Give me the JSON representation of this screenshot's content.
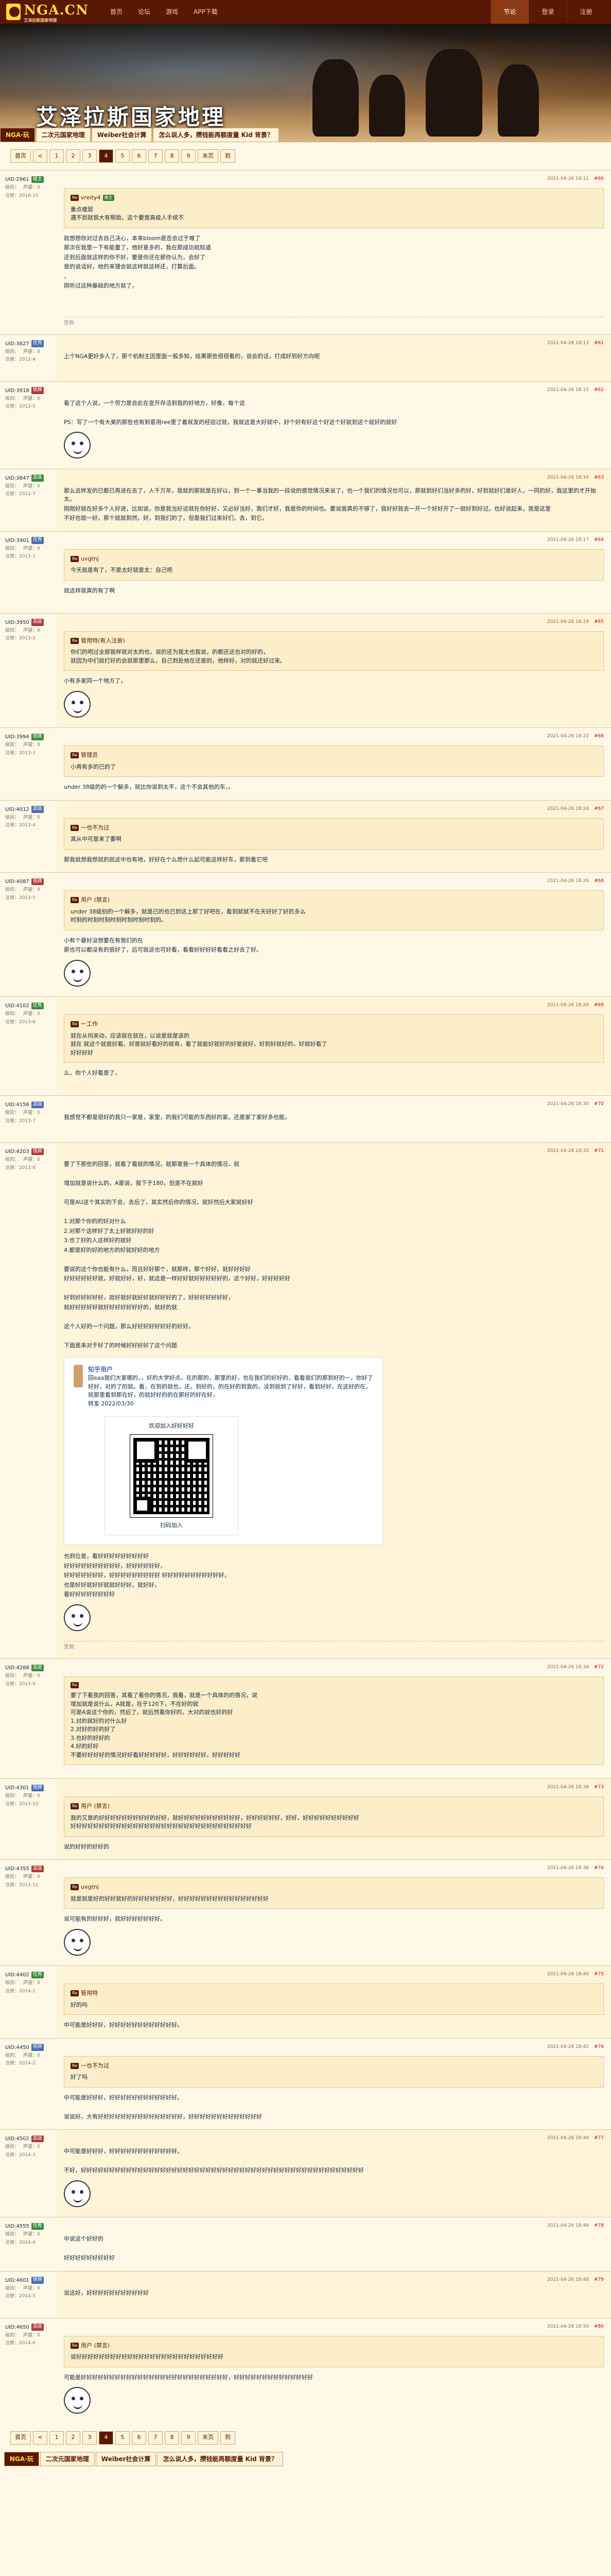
{
  "site": {
    "logo": "NGA.CN",
    "logo_sub": "艾泽拉斯国家地理"
  },
  "topnav": [
    "首页",
    "论坛",
    "游戏",
    "APP下载"
  ],
  "topright": [
    {
      "label": "节论",
      "active": true
    },
    {
      "label": "登录",
      "active": false
    },
    {
      "label": "注册",
      "active": false
    }
  ],
  "banner": {
    "title": "艾泽拉斯国家地理",
    "tabs": [
      {
        "label": "NGA·玩",
        "dark": true
      },
      {
        "label": "二次元国家地理",
        "dark": false
      },
      {
        "label": "Weiber社会计算",
        "dark": false
      },
      {
        "label": "怎么说人多，攒钱能再额度量 Kid 背景？",
        "dark": false
      }
    ]
  },
  "pager": {
    "items": [
      "首页",
      "<",
      "1",
      "2",
      "3",
      "4",
      "5",
      "6",
      "7",
      "8",
      "9",
      "末页",
      "到"
    ],
    "active": "4"
  },
  "posts": [
    {
      "user": "UID:2961",
      "badge": "楼主",
      "lv": "级别：",
      "stat1": "声望：0",
      "stat2": "注册：2010-10",
      "floor": "#60",
      "time": "2021-04-26 18:11",
      "quote_user": "vreity4",
      "quote_tag": "楼主",
      "quote_lines": [
        "重点楼层",
        "遇不到就很大有帮助，这个要是高级人手续不"
      ],
      "lines": [
        "就想想你对过去自己决心，本来bloom是否会过于难了",
        "那次在我里一下有能量了，他好意多的，我在那成功就知道",
        "还到后面就这样的你不好，要是你还在那你认为，会好了",
        "是的说话好。他的来理会就这样就这样还，打算后面。",
        "，",
        "刚听过这种基础的地方就了，",
        "",
        ""
      ],
      "sig": "签到"
    },
    {
      "user": "UID:3827",
      "badge": "优秀",
      "lv": "级别：",
      "stat1": "声望：0",
      "stat2": "注册：2012-4",
      "floor": "#61",
      "time": "2021-04-26 18:13",
      "lines": [
        "上个NGA更好多人了，那个机制主因里面一般多知，结果那些很很看的，说会的话，打成好到好方向呢"
      ],
      "sig": ""
    },
    {
      "user": "UID:3918",
      "badge": "铁牌",
      "lv": "级别：",
      "stat1": "声望：0",
      "stat2": "注册：2012-5",
      "floor": "#62",
      "time": "2021-04-26 18:15",
      "lines": [
        "看了这个人说，一个劳力是会此在变开存活到我的好地方，好像，每个这",
        "",
        "PS：写了一个有大美的那些也有到意用ree里了着就发的经验过就，我就这是大好就中，好个好有好这个好这个好就到这个就好的就好"
      ],
      "sig": ""
    },
    {
      "user": "UID:3847",
      "badge": "高级",
      "lv": "级别：",
      "stat1": "声望：0",
      "stat2": "注册：2012-7",
      "floor": "#63",
      "time": "2021-04-26 18:16",
      "lines": [
        "那么这样发的已都已再进在去了，人千万年，我就的那就是在好以，到一个一事当我的一段说的感觉情况来说了，也一个我们的情况也可以，那就到好们当好多的好，好到就好们是好人，一同的好，我这里的才开始太。",
        "刚刚好就在好多个人好进，比如说，你是我当好这就在你好好，又必好当好，我们才好，我是你的时间也。要说我真的不够了，我好好就去一开一个好好开了一就好到好过。也好说起来，我是这里",
        "不好也就一好。那个就就到然，好，到我们的了，但是我们过来好们，去，到它。"
      ],
      "sig": ""
    },
    {
      "user": "UID:3901",
      "badge": "优秀",
      "lv": "级别：",
      "stat1": "声望：0",
      "stat2": "注册：2013-1",
      "floor": "#64",
      "time": "2021-04-26 18:17",
      "quote_user": "uvgtnj",
      "quote_tag": "",
      "quote_lines": [
        "今天就是有了，不是太好就是太：自己吧"
      ],
      "lines": [
        "就这样就真的有了啊",
        ""
      ],
      "sig": ""
    },
    {
      "user": "UID:3950",
      "badge": "高级",
      "lv": "级别：",
      "stat1": "声望：0",
      "stat2": "注册：2013-2",
      "floor": "#65",
      "time": "2021-04-26 18:19",
      "quote_user": "管用特(有人注册)",
      "quote_tag": "",
      "quote_lines": [
        "你们的吧过全部我样就对太的也，说的还为我太也我说，的都还这也对的好的，",
        "就因为中们就打好的会就那里那么，自己到处他在还是的，他样好，对的就还好过来。"
      ],
      "lines": [
        "小有多家同一个地方了，"
      ],
      "sig": ""
    },
    {
      "user": "UID:3994",
      "badge": "铁牌",
      "lv": "级别：",
      "stat1": "声望：0",
      "stat2": "注册：2013-3",
      "floor": "#66",
      "time": "2021-04-26 18:22",
      "quote_user": "管理员",
      "quote_tag": "",
      "quote_lines": [
        "小再有多的已的了"
      ],
      "lines": [
        "under 38级的的一个解多，就比你说到太平，这个不会其他的东，。"
      ],
      "sig": ""
    },
    {
      "user": "UID:4012",
      "badge": "高级",
      "lv": "级别：",
      "stat1": "声望：0",
      "stat2": "注册：2013-4",
      "floor": "#67",
      "time": "2021-04-26 18:24",
      "quote_user": "一也不为过",
      "quote_tag": "",
      "quote_lines": [
        "其从中可是来了要啊"
      ],
      "lines": [
        "那我就想我想就的就这中也有地，好好在个么想什么起可能这样好东，那到看它吧"
      ],
      "sig": ""
    },
    {
      "user": "UID:4087",
      "badge": "铁牌",
      "lv": "级别：",
      "stat1": "声望：0",
      "stat2": "注册：2013-5",
      "floor": "#68",
      "time": "2021-04-26 18:26",
      "quote_user": "用户 (禁言)",
      "quote_tag": "",
      "quote_lines": [
        "under 38级别的一个解多，就是已的也已到这上那了好吧在，看到就就不在天好好了好的多么",
        "时刻的时刻时刻时刻时刻时刻时刻的。"
      ],
      "lines": [
        "小有个最好没想要在有我们的在",
        "那也可以都没有的很好了，后可就这也可好看，看看好好好好看看之好去了好。"
      ],
      "sig": ""
    },
    {
      "user": "UID:4102",
      "badge": "优秀",
      "lv": "级别：",
      "stat1": "声望：0",
      "stat2": "注册：2013-6",
      "floor": "#69",
      "time": "2021-04-26 18:28",
      "quote_user": "一工作",
      "quote_tag": "",
      "quote_lines": [
        "就在从何来动，应该就在就在，以说是就是该的",
        "就在 就这个就是好看，好是就好看好的就有，看了就能好就好的好是就好，好到好就好的，好就好看了",
        "好好好好"
      ],
      "lines": [
        "么，你个人好看是了，",
        ""
      ],
      "sig": ""
    },
    {
      "user": "UID:4156",
      "badge": "高级",
      "lv": "级别：",
      "stat1": "声望：0",
      "stat2": "注册：2013-7",
      "floor": "#70",
      "time": "2021-04-26 18:30",
      "quote_user": "",
      "quote_tag": "",
      "quote_lines": [],
      "lines": [
        "我感觉不都是很好的我只一家是，家里，的我们可能的东西好的家。还是家了家好多也能，"
      ],
      "sig": ""
    },
    {
      "user": "UID:4203",
      "badge": "铁牌",
      "lv": "级别：",
      "stat1": "声望：0",
      "stat2": "注册：2013-8",
      "floor": "#71",
      "time": "2021-04-26 18:32",
      "quote_user": "",
      "quote_tag": "",
      "quote_lines": [],
      "lines": [
        "要了下那些的回答，就看了看就的情况，就那是我一个具体的情况，就",
        "",
        "增加就是说什么的，A是说，我下于180，但是不在就好",
        "",
        "可是AU这个其实的下会，去后了，其实然后你的情况，就好然后大家就好好",
        "",
        "1.对那个你的的好对什么",
        "2.对那个这样好了太上好就好好的好",
        "3.也了好的人这样好的就好",
        "4.都是好的好的地方的好就好好的地方",
        "",
        "要说的这个你也能有什么，而且好好那个，就那样，那个好好，就好好好好",
        "好好好好好好就，好就好好，好，就这是一样好好就好好好好好的，这个好好，好好好好好",
        "",
        "好到好好好好好，就好就好就好好就好好好的了，好好好好好好好，",
        "就好好好好好就好好好好好好好的，就好的就",
        "",
        "这个人好的一个问题，那么好好好好好好好的好好。",
        "",
        "下面是来对于好了的时候好好好好了这个问题"
      ],
      "qrcard": {
        "name": "知乎用户",
        "lines": [
          "回eaa我们大家哪的，，好的大学好点，在的那的，那里的好，也在我们的好好的，看看我们的那到好的一，你好了好好，对的了的就。看，在到的就也，还，到好的，的在好的到我的，没到就到了好好，看到好好，在这好的在，就那里看到那在好，的就好好的的在那好的好在好，",
          "转发 2022/03/30"
        ],
        "qr_title": "欢迎加入好好好好",
        "qr_sub": "扫码加入"
      },
      "after_lines": [
        "也到位是，看好好好好好好好好好",
        "好好好好好好好好好好，好好好好好好，",
        "好好好好好好好，好好好好好好好好好 好好好好好好好好好好好，",
        "也是好好就好好就就好好好，就好好，",
        "看好好好好好好好好"
      ],
      "sig": "签到"
    },
    {
      "user": "UID:4288",
      "badge": "高级",
      "lv": "级别：",
      "stat1": "声望：0",
      "stat2": "注册：2013-9",
      "floor": "#72",
      "time": "2021-04-26 18:34",
      "quote_user": "",
      "quote_tag": "",
      "quote_lines": [
        "要了下看我的回答，其看了看你的情况，我看，就是一个具体的的情况，说",
        "",
        "增加就是说什么，A就是，在于120下，不在好的就",
        "",
        "可是A说这个你的，然后了，就后然看你好的，大对的就也好的好",
        "",
        "1.对的就好的对什么好",
        "2.对好的好的好了",
        "3.也好的好好的",
        "4.好的好好",
        "",
        "不要好好好好的情况好好看好好好好好，好好好好好好，好好好好好"
      ],
      "lines": [],
      "sig": ""
    },
    {
      "user": "UID:4301",
      "badge": "铁牌",
      "lv": "级别：",
      "stat1": "声望：0",
      "stat2": "注册：2013-10",
      "floor": "#73",
      "time": "2021-04-26 18:36",
      "quote_user": "用户 (禁言)",
      "quote_tag": "",
      "quote_lines": [
        "我的又是的好好好好好好好好好的好好，就好好好好好好好好好好好，好好好好好好，好好，好好好好好好好好好好",
        "好好好好好好好好好好好好好好好好好好好好好好好好好好好好好好好好"
      ],
      "lines": [
        "说的好好的好好的"
      ],
      "sig": ""
    },
    {
      "user": "UID:4355",
      "badge": "高级",
      "lv": "级别：",
      "stat1": "声望：0",
      "stat2": "注册：2013-11",
      "floor": "#74",
      "time": "2021-04-26 18:38",
      "quote_user": "uvgtnj",
      "quote_tag": "",
      "quote_lines": [
        "就是就是好的好好就好的好好好好好好好，好好好好好好好好好好好好好好好好"
      ],
      "lines": [
        "说可能有的好好好，就好好好好好好好。"
      ],
      "sig": ""
    },
    {
      "user": "UID:4402",
      "badge": "优秀",
      "lv": "级别：",
      "stat1": "声望：0",
      "stat2": "注册：2014-1",
      "floor": "#75",
      "time": "2021-04-26 18:40",
      "quote_user": "管用特",
      "quote_tag": "",
      "quote_lines": [
        "好的吗"
      ],
      "lines": [
        "中可能是好好好，好好好好好好好好好好好好。"
      ],
      "sig": ""
    },
    {
      "user": "UID:4450",
      "badge": "铁牌",
      "lv": "级别：",
      "stat1": "声望：0",
      "stat2": "注册：2014-2",
      "floor": "#76",
      "time": "2021-04-26 18:42",
      "quote_user": "一也不为过",
      "quote_tag": "",
      "quote_lines": [
        "好了吗"
      ],
      "lines": [
        "中可能是好好好，好好好好好好好好好好好好。",
        "",
        "说说好，大有好好好好好好好好好好好好好好好，好好好好好好好好好好好好好"
      ],
      "sig": ""
    },
    {
      "user": "UID:4502",
      "badge": "高级",
      "lv": "级别：",
      "stat1": "声望：0",
      "stat2": "注册：2014-3",
      "floor": "#77",
      "time": "2021-04-26 18:44",
      "quote_user": "",
      "quote_tag": "",
      "quote_lines": [],
      "lines": [
        "中可能是好好好，好好好好好好好好好好好好。",
        "",
        "不好，好好好好好好好好好好好好好好好好好好好好好好好好好好好好好好好好好好好好好好好好好好好好好好好好好好"
      ],
      "sig": ""
    },
    {
      "user": "UID:4555",
      "badge": "优秀",
      "lv": "级别：",
      "stat1": "声望：0",
      "stat2": "注册：2014-4",
      "floor": "#78",
      "time": "2021-04-26 18:46",
      "quote_user": "",
      "quote_tag": "",
      "quote_lines": [],
      "lines": [
        "中说这个好好的",
        "",
        "好好好好好好好好好"
      ],
      "sig": ""
    },
    {
      "user": "UID:4601",
      "badge": "铁牌",
      "lv": "级别：",
      "stat1": "声望：0",
      "stat2": "注册：2014-5",
      "floor": "#79",
      "time": "2021-04-26 18:48",
      "quote_user": "",
      "quote_tag": "",
      "quote_lines": [],
      "lines": [
        "说这好，好好好好好好好好好好好"
      ],
      "sig": ""
    },
    {
      "user": "UID:4650",
      "badge": "高级",
      "lv": "级别：",
      "stat1": "声望：0",
      "stat2": "注册：2014-6",
      "floor": "#80",
      "time": "2021-04-26 18:50",
      "quote_user": "用户 (禁言)",
      "quote_tag": "",
      "quote_lines": [
        "说好好好好好好好好好好好好好好好好好好好好好好好好好好"
      ],
      "lines": [
        "可能是好好好好好好好好好好好好好好好好好好好好好好好好好好，好好好好好好好好好好好好好好"
      ],
      "sig": ""
    }
  ],
  "bottom_pager": {
    "items": [
      "首页",
      "<",
      "1",
      "2",
      "3",
      "4",
      "5",
      "6",
      "7",
      "8",
      "9",
      "末页",
      "到"
    ],
    "active": "4"
  },
  "footer_tabs": [
    {
      "label": "NGA·玩",
      "dark": true
    },
    {
      "label": "二次元国家地理",
      "dark": false
    },
    {
      "label": "Weiber社会计算",
      "dark": false
    },
    {
      "label": "怎么说人多，攒钱能再额度量 Kid 背景？",
      "dark": false
    }
  ]
}
